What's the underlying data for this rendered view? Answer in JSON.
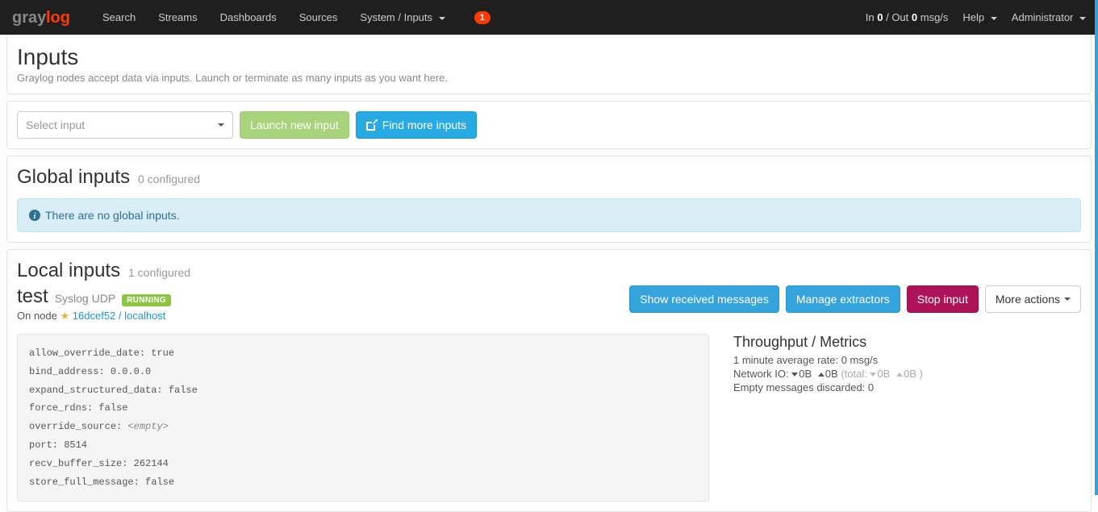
{
  "nav": {
    "items": [
      {
        "label": "Search"
      },
      {
        "label": "Streams"
      },
      {
        "label": "Dashboards"
      },
      {
        "label": "Sources"
      },
      {
        "label": "System / Inputs",
        "dropdown": true,
        "active": true
      }
    ],
    "notification_count": "1",
    "throughput_prefix": "In ",
    "throughput_in": "0",
    "throughput_mid": " / Out ",
    "throughput_out": "0",
    "throughput_suffix": " msg/s",
    "help": "Help",
    "user": "Administrator"
  },
  "header": {
    "title": "Inputs",
    "desc": "Graylog nodes accept data via inputs. Launch or terminate as many inputs as you want here."
  },
  "toolbar": {
    "select_placeholder": "Select input",
    "launch": "Launch new input",
    "find_more": "Find more inputs"
  },
  "global": {
    "title": "Global inputs",
    "sub": "0 configured",
    "alert": "There are no global inputs."
  },
  "local": {
    "title": "Local inputs",
    "sub": "1 configured",
    "input": {
      "name": "test",
      "type": "Syslog UDP",
      "status": "RUNNING",
      "node_prefix": "On node ",
      "node_link": "16dcef52 / localhost",
      "actions": {
        "show": "Show received messages",
        "extractors": "Manage extractors",
        "stop": "Stop input",
        "more": "More actions"
      },
      "config": [
        {
          "k": "allow_override_date",
          "v": "true"
        },
        {
          "k": "bind_address",
          "v": "0.0.0.0"
        },
        {
          "k": "expand_structured_data",
          "v": "false"
        },
        {
          "k": "force_rdns",
          "v": "false"
        },
        {
          "k": "override_source",
          "v": "<empty>",
          "empty": true
        },
        {
          "k": "port",
          "v": "8514"
        },
        {
          "k": "recv_buffer_size",
          "v": "262144"
        },
        {
          "k": "store_full_message",
          "v": "false"
        }
      ],
      "metrics": {
        "title": "Throughput / Metrics",
        "rate": "1 minute average rate: 0 msg/s",
        "netio_label": "Network IO: ",
        "netio_down": "0B",
        "netio_up": "0B",
        "netio_total_label": "(total: ",
        "netio_total_down": "0B",
        "netio_total_up": "0B",
        "netio_total_close": " )",
        "empty": "Empty messages discarded: 0"
      }
    }
  }
}
